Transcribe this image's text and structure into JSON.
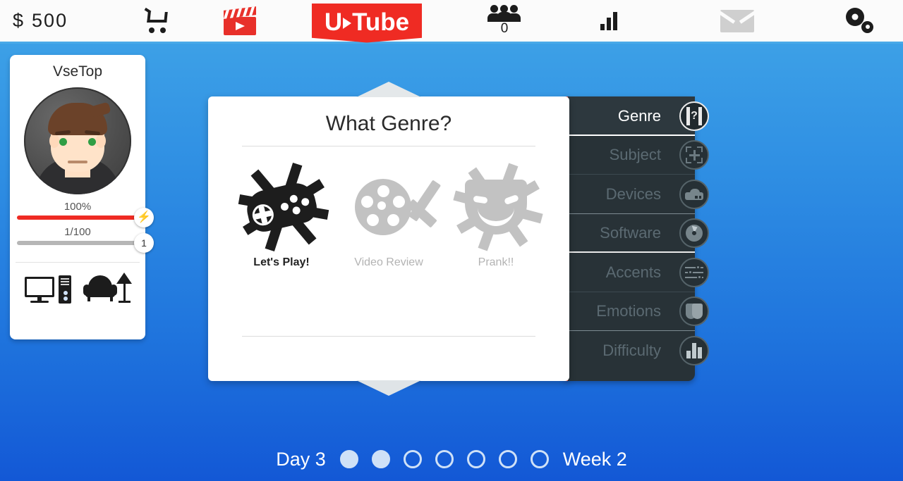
{
  "topbar": {
    "money": {
      "currency": "$",
      "amount": "500"
    },
    "shop_icon": "cart-icon",
    "videos_icon": "clapperboard-icon",
    "logo": {
      "part1": "U",
      "part2": "Tube"
    },
    "subscribers": {
      "icon": "people-icon",
      "count": "0"
    },
    "stats_icon": "bar-chart-icon",
    "mail_icon": "envelope-icon",
    "settings_icon": "gears-icon"
  },
  "character": {
    "name": "VseTop",
    "avatar_icon": "avatar",
    "energy": {
      "label": "100%",
      "badge": "⚡",
      "percent": 100,
      "color": "#ef2b23"
    },
    "experience": {
      "label": "1/100",
      "badge": "1",
      "percent": 100,
      "color": "#b6b6b6"
    },
    "equipment": [
      {
        "name": "pc-icon",
        "label": "PC"
      },
      {
        "name": "furniture-icon",
        "label": "Armchair and lamp"
      }
    ]
  },
  "dialog": {
    "title": "What Genre?",
    "options": [
      {
        "label": "Let's Play!",
        "icon": "gamepad-icon",
        "state": "active"
      },
      {
        "label": "Video Review",
        "icon": "film-reel-icon",
        "state": "dim"
      },
      {
        "label": "Prank!!",
        "icon": "theater-mask-icon",
        "state": "dim"
      }
    ]
  },
  "side_menu": {
    "items": [
      {
        "label": "Genre",
        "icon": "film-question-icon",
        "state": "active"
      },
      {
        "label": "Subject",
        "icon": "frame-plus-icon",
        "state": "dim"
      },
      {
        "label": "Devices",
        "icon": "camera-icon",
        "state": "dim"
      },
      {
        "label": "Software",
        "icon": "disc-icon",
        "state": "dim"
      },
      {
        "label": "Accents",
        "icon": "sliders-icon",
        "state": "dim"
      },
      {
        "label": "Emotions",
        "icon": "masks-icon",
        "state": "dim"
      },
      {
        "label": "Difficulty",
        "icon": "bar-chart-icon",
        "state": "dim"
      }
    ],
    "accent_color": "#e0382e",
    "background_color": "#283237"
  },
  "bottom_bar": {
    "day_label": "Day 3",
    "week_label": "Week 2",
    "dots": [
      true,
      true,
      false,
      false,
      false,
      false,
      false
    ]
  }
}
